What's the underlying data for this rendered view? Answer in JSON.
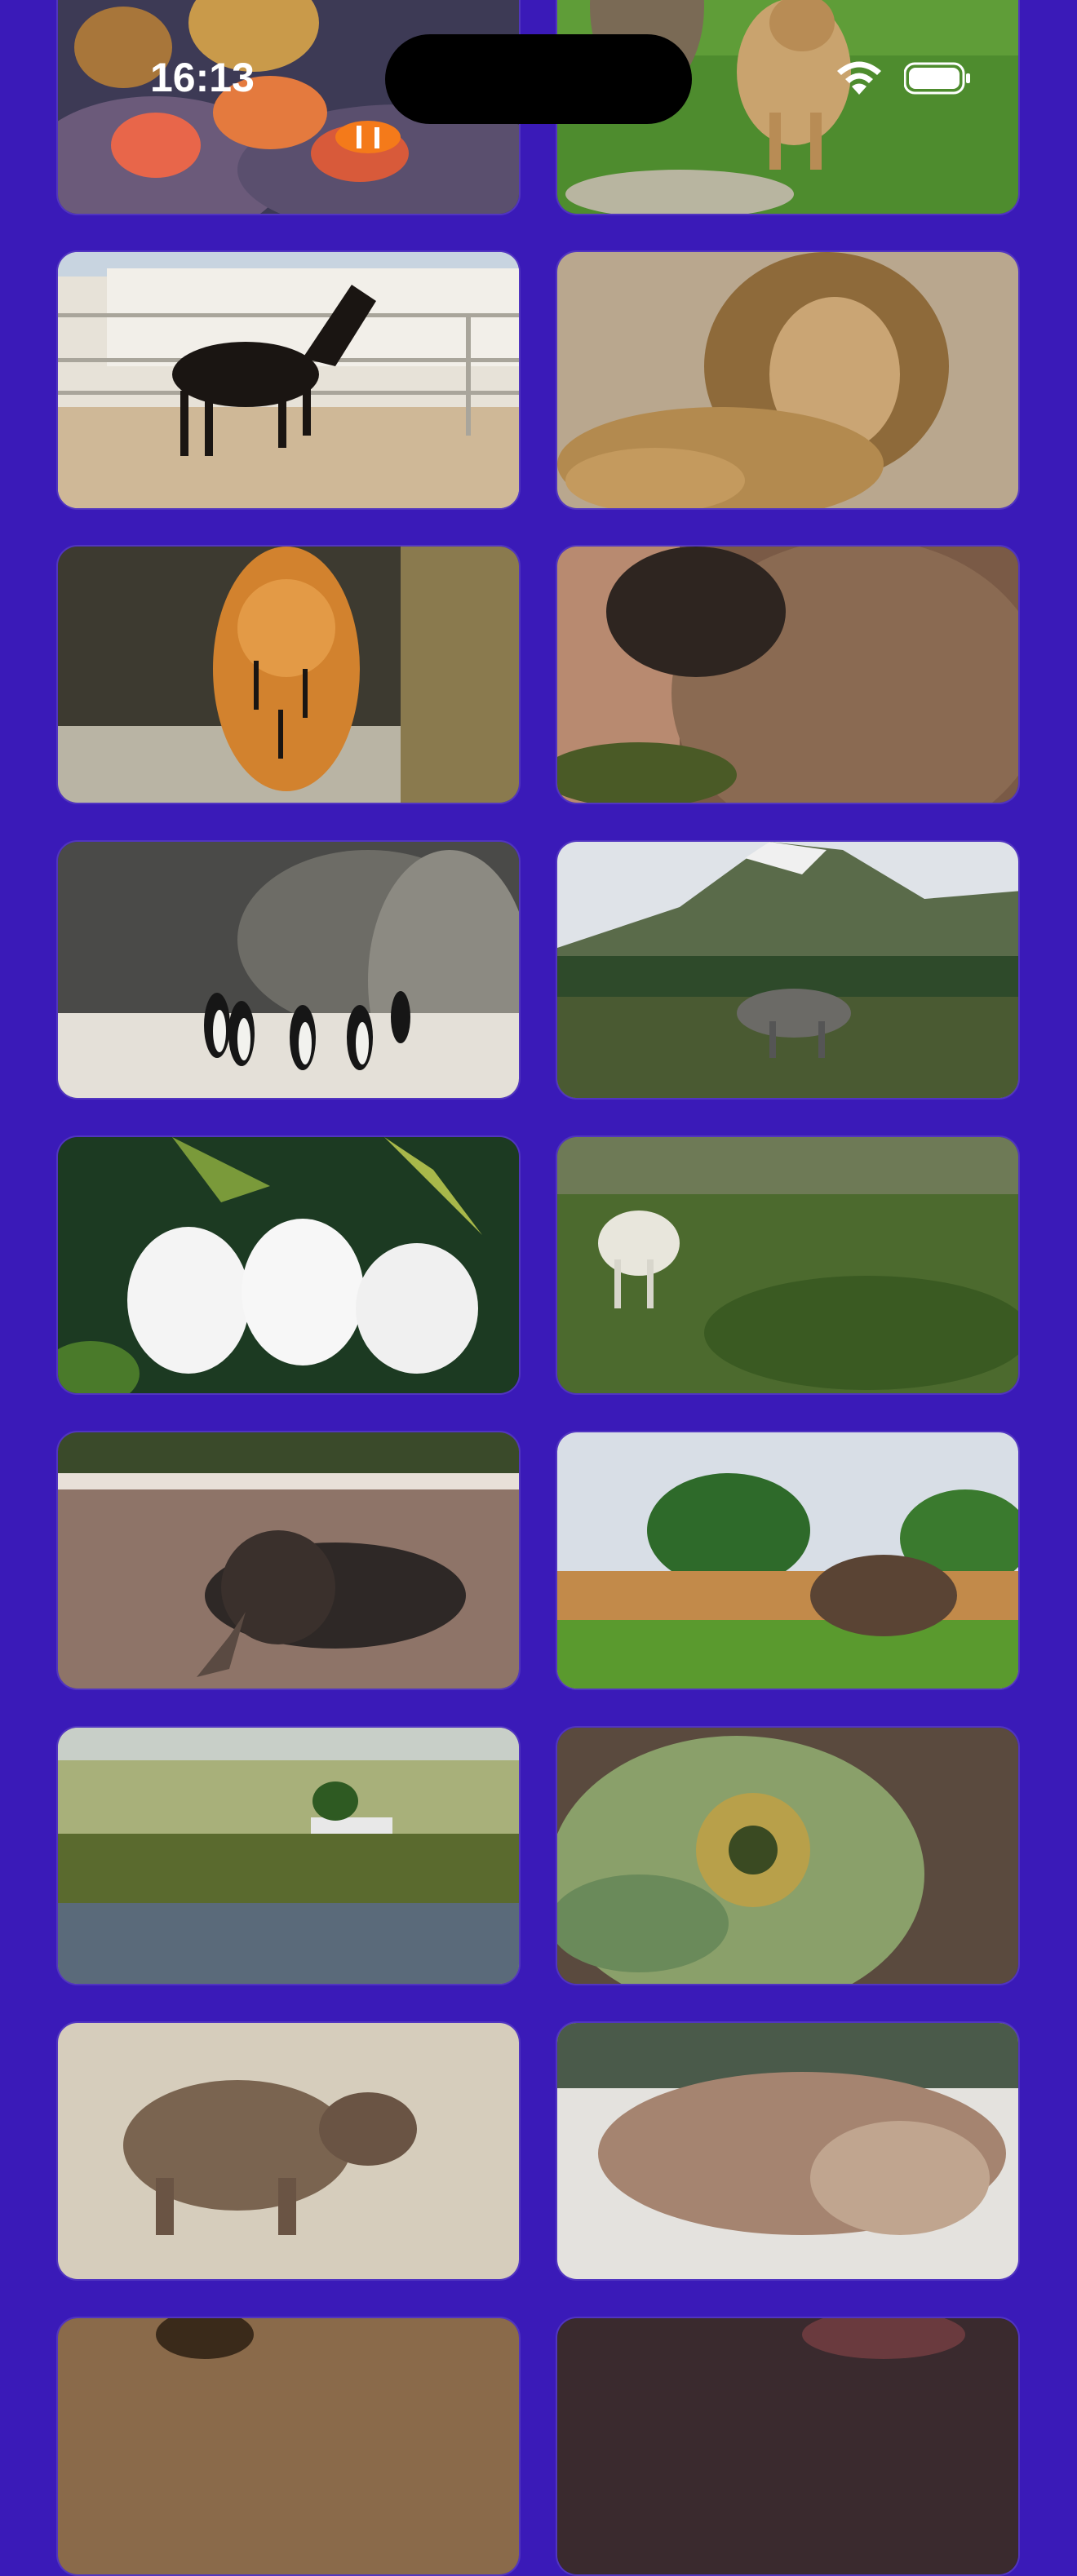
{
  "status_bar": {
    "time": "16:13",
    "icons": [
      "wifi-icon",
      "battery-icon"
    ]
  },
  "gallery": {
    "tiles": [
      {
        "subject": "clownfish-coral-reef"
      },
      {
        "subject": "lioness-walking"
      },
      {
        "subject": "black-horse-trotting"
      },
      {
        "subject": "lion-lying"
      },
      {
        "subject": "tiger-walking"
      },
      {
        "subject": "bear-closeup"
      },
      {
        "subject": "penguins-walking"
      },
      {
        "subject": "horse-grazing-mountain"
      },
      {
        "subject": "three-white-rabbits"
      },
      {
        "subject": "white-horse-hillside"
      },
      {
        "subject": "elephant-in-water"
      },
      {
        "subject": "elephant-savanna"
      },
      {
        "subject": "zebras-river"
      },
      {
        "subject": "chameleon-closeup"
      },
      {
        "subject": "rhinoceros"
      },
      {
        "subject": "sea-lion-sleeping"
      },
      {
        "subject": "giraffe-partial"
      },
      {
        "subject": "animal-partial"
      }
    ]
  },
  "colors": {
    "background": "#3a1ab8",
    "status_text": "#ffffff",
    "island": "#000000"
  }
}
